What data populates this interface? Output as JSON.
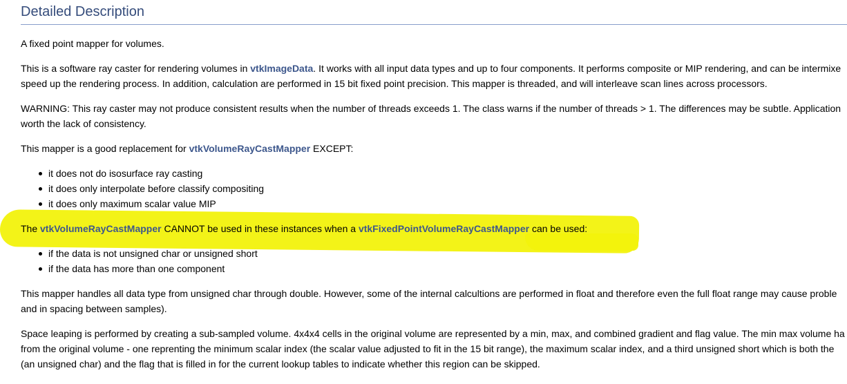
{
  "heading": "Detailed Description",
  "p1": "A fixed point mapper for volumes.",
  "p2": {
    "pre": "This is a software ray caster for rendering volumes in ",
    "link": "vtkImageData",
    "post": ". It works with all input data types and up to four components. It performs composite or MIP rendering, and can be intermixe",
    "line2": "speed up the rendering process. In addition, calculation are performed in 15 bit fixed point precision. This mapper is threaded, and will interleave scan lines across processors."
  },
  "p3": {
    "line1": "WARNING: This ray caster may not produce consistent results when the number of threads exceeds 1. The class warns if the number of threads > 1. The differences may be subtle. Application",
    "line2": "worth the lack of consistency."
  },
  "p4": {
    "pre": "This mapper is a good replacement for ",
    "link": "vtkVolumeRayCastMapper",
    "post": " EXCEPT:"
  },
  "list1": [
    "it does not do isosurface ray casting",
    "it does only interpolate before classify compositing",
    "it does only maximum scalar value MIP"
  ],
  "p5": {
    "pre": "The ",
    "link1": "vtkVolumeRayCastMapper",
    "mid": " CANNOT be used in these instances when a ",
    "link2": "vtkFixedPointVolumeRayCastMapper",
    "post": " can be used:"
  },
  "list2": [
    "if the data is not unsigned char or unsigned short",
    "if the data has more than one component"
  ],
  "p6": {
    "line1": "This mapper handles all data type from unsigned char through double. However, some of the internal calcultions are performed in float and therefore even the full float range may cause proble",
    "line2": "and in spacing between samples)."
  },
  "p7": {
    "line1": "Space leaping is performed by creating a sub-sampled volume. 4x4x4 cells in the original volume are represented by a min, max, and combined gradient and flag value. The min max volume ha",
    "line2": "from the original volume - one reprenting the minimum scalar index (the scalar value adjusted to fit in the 15 bit range), the maximum scalar index, and a third unsigned short which is both the",
    "line3": "(an unsigned char) and the flag that is filled in for the current lookup tables to indicate whether this region can be skipped."
  },
  "colors": {
    "heading": "#354c7b",
    "link": "#3d578c",
    "highlight": "#f2f20c"
  }
}
